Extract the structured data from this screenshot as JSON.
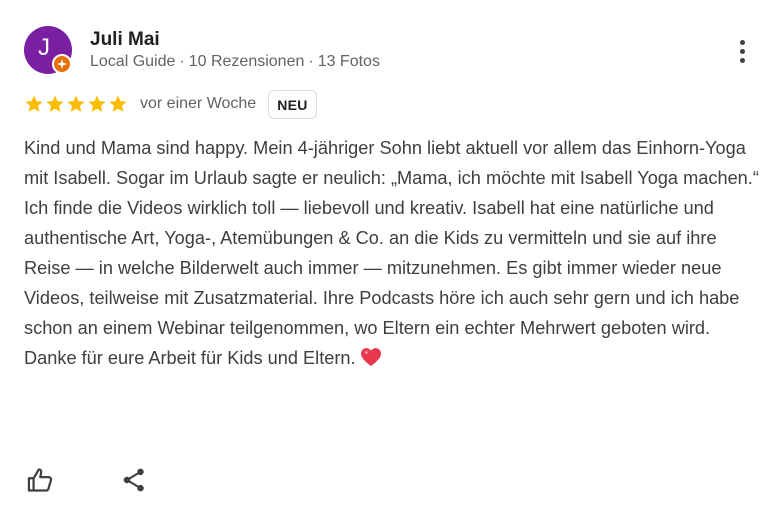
{
  "review": {
    "author": {
      "initial": "J",
      "name": "Juli Mai",
      "role": "Local Guide",
      "reviews": "10 Rezensionen",
      "photos": "13 Fotos",
      "separator": "·",
      "avatar_color": "#7b1fa2",
      "badge_color": "#e8710a"
    },
    "rating": 5,
    "rating_max": 5,
    "star_color": "#fbbc04",
    "time": "vor einer Woche",
    "new_badge": "NEU",
    "text_paragraphs": [
      "Kind und Mama sind happy. Mein 4-jähriger Sohn liebt aktuell vor allem das Einhorn-Yoga mit Isabell. Sogar im Urlaub sagte er neulich: „Mama, ich möchte mit Isabell Yoga machen.“",
      "Ich finde die Videos wirklich toll — liebevoll und kreativ. Isabell hat eine natürliche und authentische Art, Yoga-, Atemübungen & Co. an die Kids zu vermitteln und sie auf ihre Reise — in welche Bilderwelt auch immer — mitzunehmen. Es gibt immer wieder neue Videos, teilweise mit Zusatzmaterial. Ihre Podcasts höre ich auch sehr gern und ich habe schon an einem Webinar teilgenommen, wo Eltern ein echter Mehrwert geboten wird. Danke für eure Arbeit für Kids und Eltern."
    ],
    "emoji": "heart",
    "emoji_color": "#e8384f"
  },
  "icons": {
    "more": "more-vert-icon",
    "like": "thumb-up-icon",
    "share": "share-icon",
    "badge": "local-guide-star-icon"
  }
}
